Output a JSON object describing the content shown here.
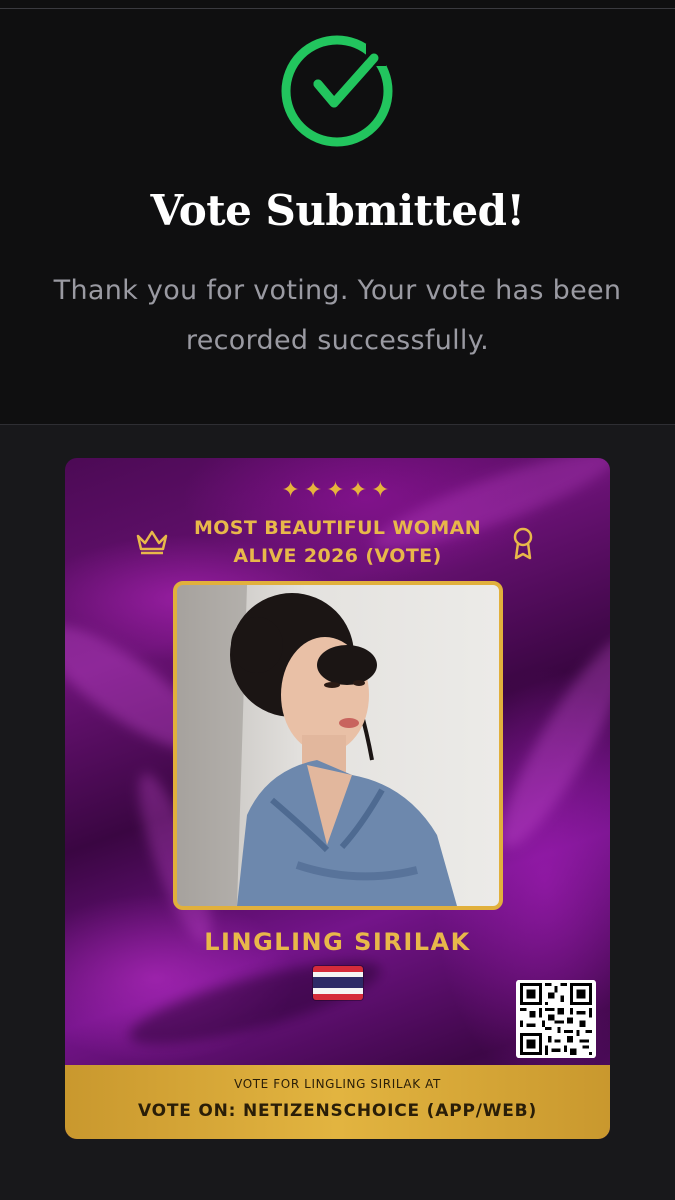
{
  "status": {
    "title": "Vote Submitted!",
    "message": "Thank you for voting. Your vote has been recorded successfully.",
    "icon": "check-circle-icon",
    "accent_color": "#22c55e"
  },
  "card": {
    "stars": "✦✦✦✦✦",
    "title": "MOST BEAUTIFUL WOMAN ALIVE 2026 (VOTE)",
    "nominee_name": "LINGLING SIRILAK",
    "flag": "thailand-flag",
    "footer_line1": "VOTE FOR LINGLING SIRILAK AT",
    "footer_line2": "VOTE ON: NETIZENSCHOICE (APP/WEB)",
    "gold_color": "#e8b84a",
    "background_color": "#5e1070"
  }
}
